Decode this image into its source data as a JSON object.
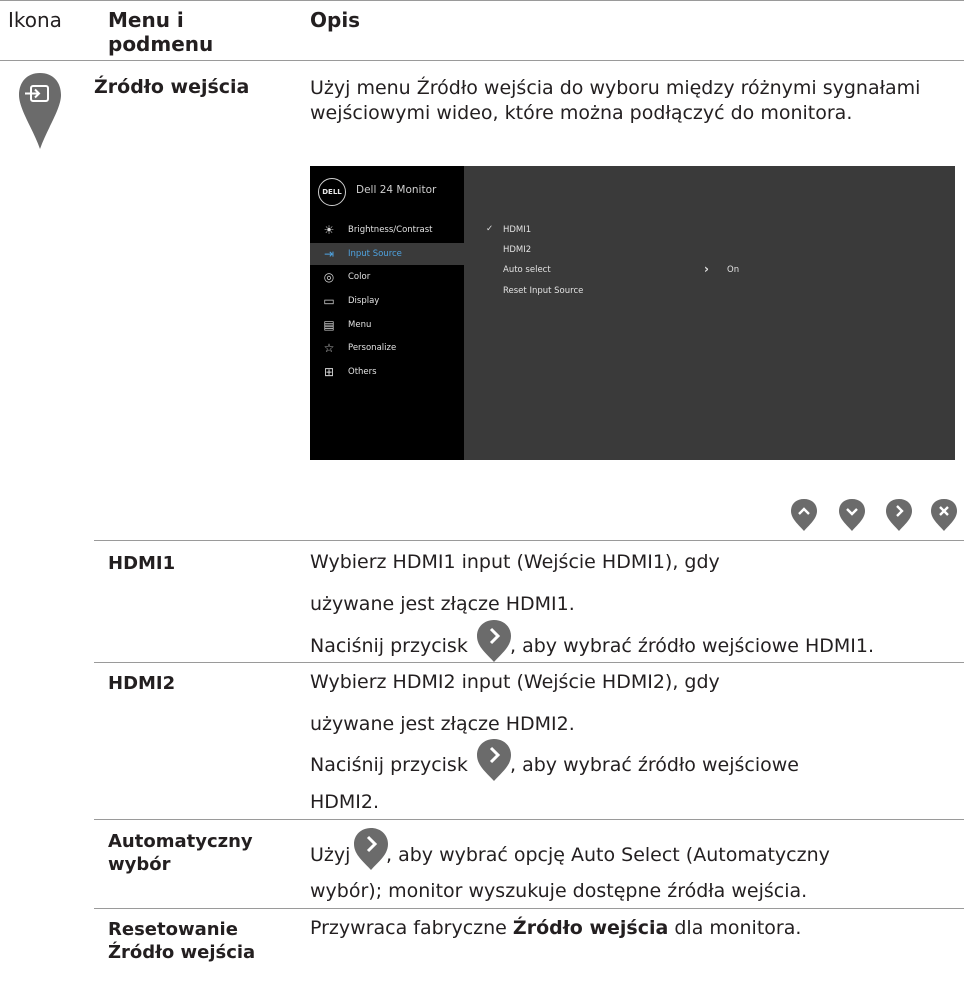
{
  "header": {
    "col_icon": "Ikona",
    "col_menu": "Menu i podmenu",
    "col_desc": "Opis"
  },
  "input_source": {
    "title": "Źródło wejścia",
    "description": "Użyj menu Źródło wejścia do wyboru między różnymi sygnałami wejściowymi wideo, które można podłączyć do monitora."
  },
  "osd": {
    "brand": "DELL",
    "title": "Dell 24 Monitor",
    "menu": [
      {
        "icon": "brightness-icon",
        "label": "Brightness/Contrast"
      },
      {
        "icon": "input-source-icon",
        "label": "Input Source"
      },
      {
        "icon": "color-icon",
        "label": "Color"
      },
      {
        "icon": "display-icon",
        "label": "Display"
      },
      {
        "icon": "menu-icon",
        "label": "Menu"
      },
      {
        "icon": "star-icon",
        "label": "Personalize"
      },
      {
        "icon": "others-icon",
        "label": "Others"
      }
    ],
    "selected_item": "Input Source",
    "options": {
      "check": "✓",
      "hdmi1": "HDMI1",
      "hdmi2": "HDMI2",
      "auto_select": "Auto select",
      "auto_value": "On",
      "reset": "Reset Input Source"
    }
  },
  "nav_buttons": [
    "up-button-icon",
    "down-button-icon",
    "right-button-icon",
    "close-button-icon"
  ],
  "rows": {
    "hdmi1": {
      "label": "HDMI1",
      "line1": "Wybierz HDMI1 input (Wejście HDMI1), gdy",
      "line2": "używane jest złącze HDMI1.",
      "line3_pre": "Naciśnij przycisk",
      "line3_post": ", aby wybrać źródło wejściowe HDMI1."
    },
    "hdmi2": {
      "label": "HDMI2",
      "line1": "Wybierz HDMI2 input (Wejście HDMI2), gdy",
      "line2": "używane jest złącze HDMI2.",
      "line3_pre": "Naciśnij przycisk",
      "line3_post": ", aby wybrać źródło wejściowe",
      "line4": "HDMI2."
    },
    "auto": {
      "label_1": "Automatyczny",
      "label_2": "wybór",
      "line1_pre": "Użyj",
      "line1_post": ", aby wybrać opcję Auto Select (Automatyczny",
      "line2": "wybór); monitor wyszukuje dostępne źródła wejścia."
    },
    "reset": {
      "label_1": "Resetowanie",
      "label_2": "Źródło wejścia",
      "desc_pre": "Przywraca fabryczne ",
      "desc_bold": "Źródło wejścia",
      "desc_post": " dla monitora."
    }
  },
  "colors": {
    "osd_highlight": "#4fa3e0",
    "osd_panel": "#3a3a3a",
    "icon_gray": "#6b6b6b"
  }
}
